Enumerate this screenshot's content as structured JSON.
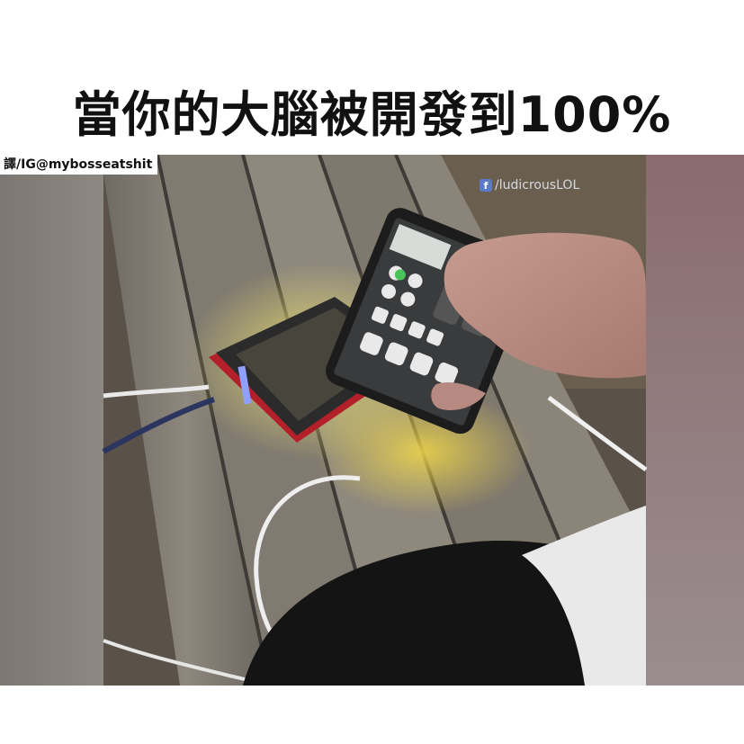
{
  "meme": {
    "title": "當你的大腦被開發到100%",
    "credit": "譯/IG@mybosseatshit",
    "watermark": {
      "icon": "facebook-icon",
      "text": "/ludicrousLOL"
    }
  }
}
